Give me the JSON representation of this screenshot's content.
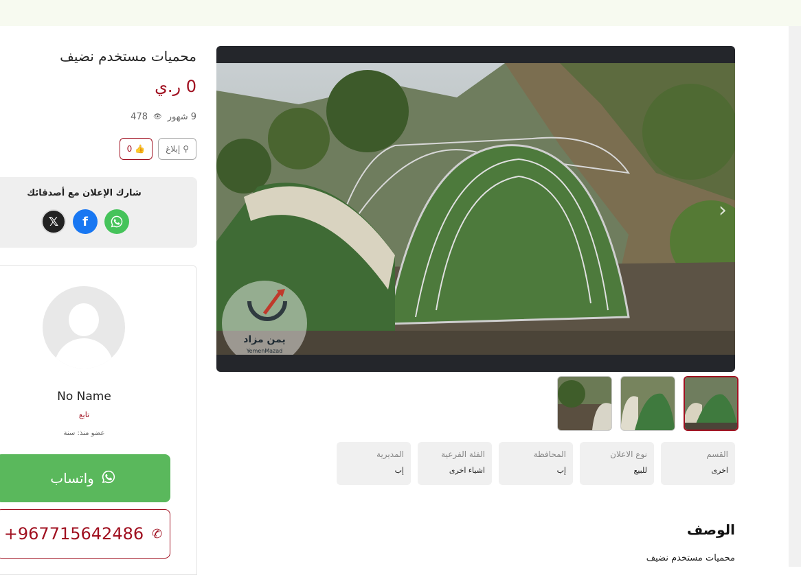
{
  "ad": {
    "title": "محميات مستخدم نضيف",
    "price": "0 ر.ي",
    "age": "9 شهور",
    "views": "478",
    "report_label": "إبلاغ",
    "likes": "0"
  },
  "share": {
    "title": "شارك الإعلان مع أصدقائك",
    "icons": [
      "x-icon",
      "facebook-icon",
      "whatsapp-icon"
    ]
  },
  "seller": {
    "name": "No Name",
    "role": "تابع",
    "member_since": "عضو منذ: سنة",
    "whatsapp_label": "واتساب",
    "phone": "+967715642486"
  },
  "gallery": {
    "watermark_ar": "يمن مزاد",
    "watermark_en": "YemenMazad",
    "thumbnail_count": 3
  },
  "attributes": [
    {
      "label": "القسم",
      "value": "اخرى"
    },
    {
      "label": "نوع الاعلان",
      "value": "للبيع"
    },
    {
      "label": "المحافظة",
      "value": "إب"
    },
    {
      "label": "الفئة الفرعية",
      "value": "اشياء اخرى"
    },
    {
      "label": "المديرية",
      "value": "إب"
    }
  ],
  "description": {
    "title": "الوصف",
    "text": "محميات مستخدم نضيف"
  },
  "colors": {
    "accent": "#a01020",
    "whatsapp": "#5ab85c",
    "facebook": "#1877f2"
  }
}
